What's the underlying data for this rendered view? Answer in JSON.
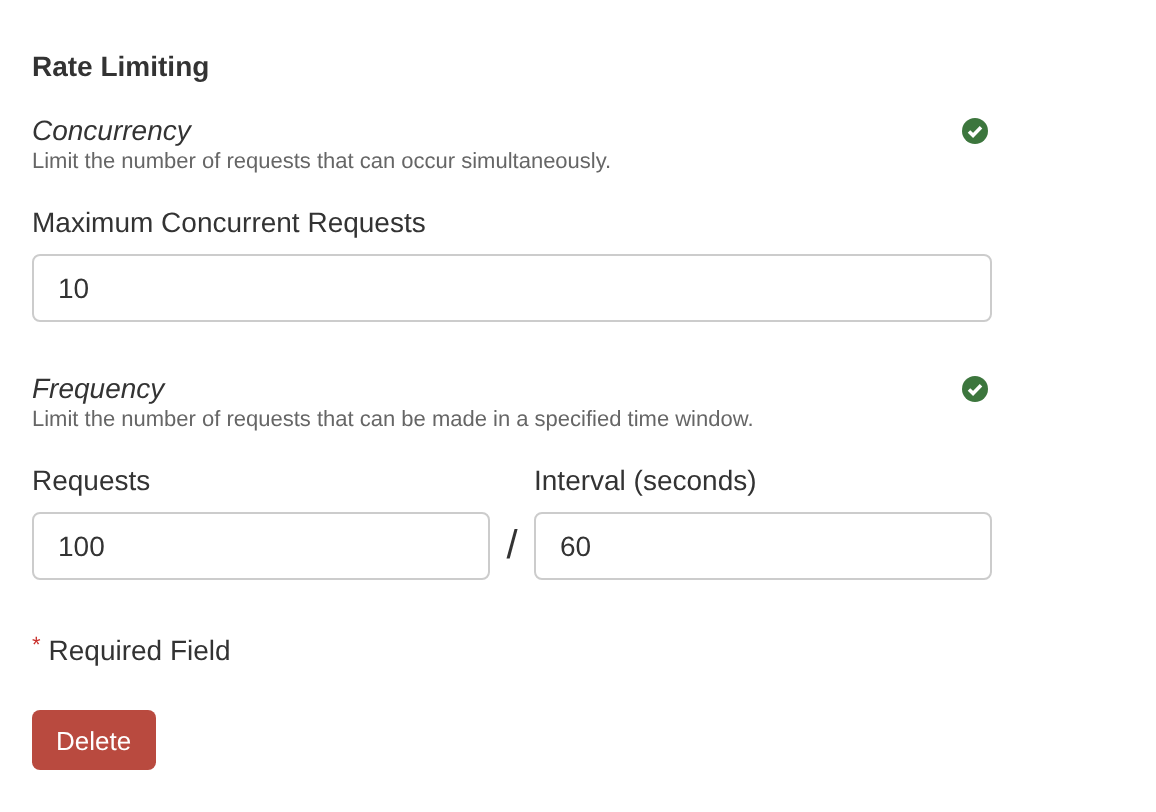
{
  "heading": "Rate Limiting",
  "sections": [
    {
      "kind": "single",
      "title": "Concurrency",
      "description": "Limit the number of requests that can occur simultaneously.",
      "valid": true,
      "fields": [
        {
          "label": "Maximum Concurrent Requests",
          "value": "10"
        }
      ]
    },
    {
      "kind": "ratio",
      "title": "Frequency",
      "description": "Limit the number of requests that can be made in a specified time window.",
      "valid": true,
      "separator": "/",
      "fields": [
        {
          "label": "Requests",
          "value": "100"
        },
        {
          "label": "Interval (seconds)",
          "value": "60"
        }
      ]
    }
  ],
  "required_note": {
    "marker": "*",
    "text": "Required Field"
  },
  "buttons": [
    {
      "label": "Delete",
      "kind": "danger"
    }
  ]
}
